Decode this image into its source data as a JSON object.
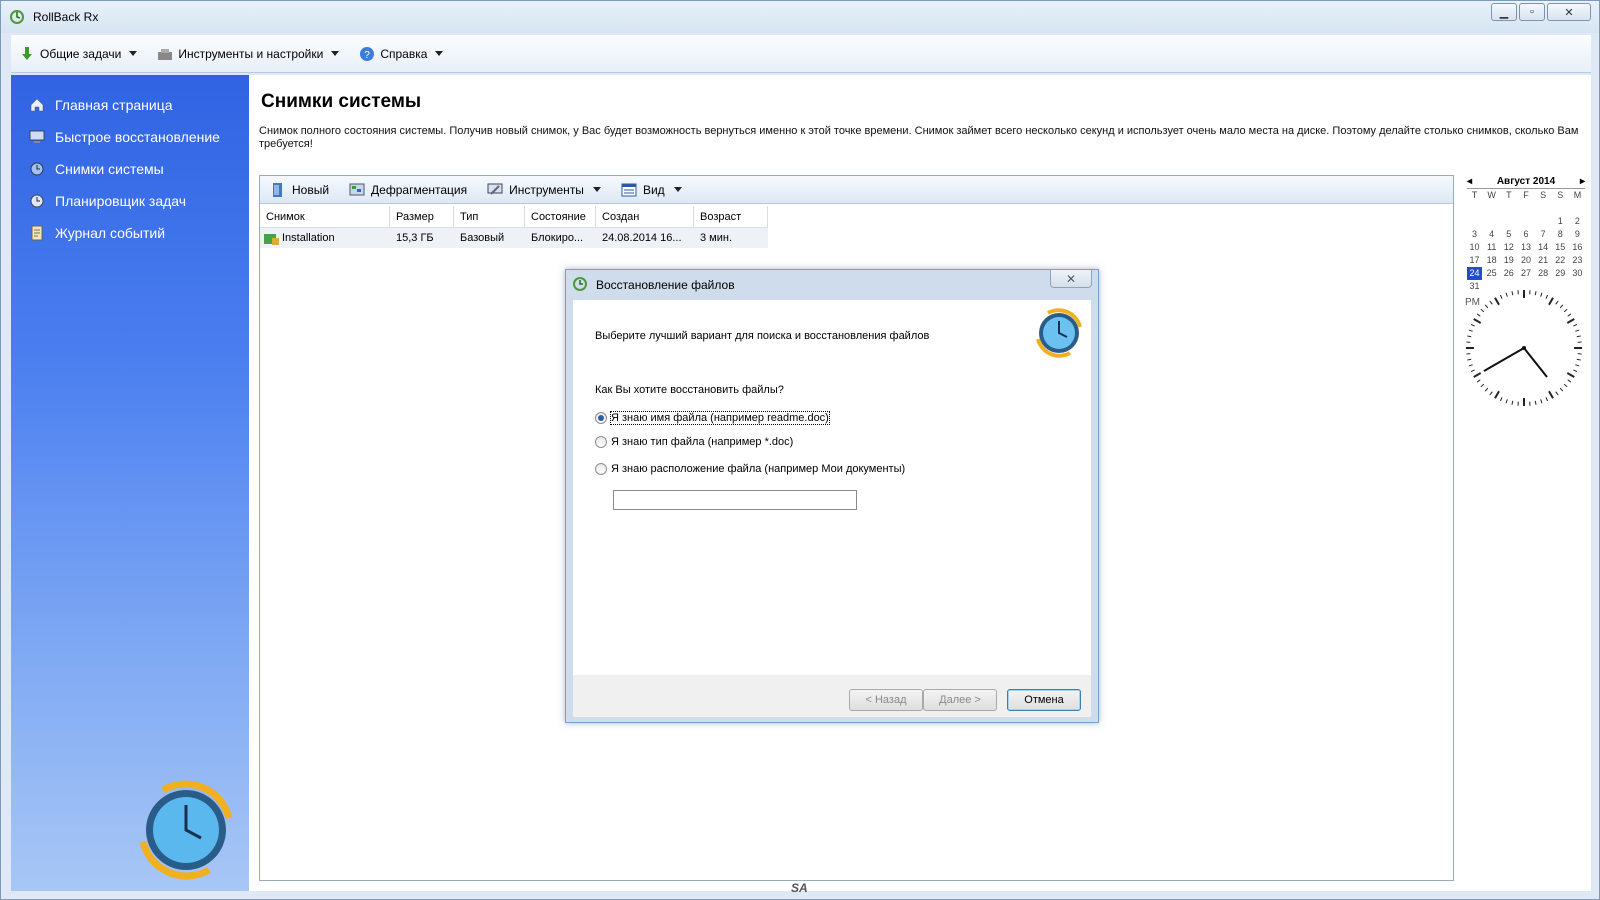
{
  "window": {
    "title": "RollBack Rx",
    "btn_min": "▁",
    "btn_max": "▫",
    "btn_close": "✕"
  },
  "menubar": {
    "items": [
      {
        "label": "Общие задачи",
        "icon": "download-arrow-icon"
      },
      {
        "label": "Инструменты и настройки",
        "icon": "tools-icon"
      },
      {
        "label": "Справка",
        "icon": "help-icon"
      }
    ]
  },
  "sidebar": {
    "items": [
      {
        "label": "Главная страница",
        "icon": "home-icon"
      },
      {
        "label": "Быстрое восстановление",
        "icon": "monitor-icon"
      },
      {
        "label": "Снимки системы",
        "icon": "snapshot-icon"
      },
      {
        "label": "Планировщик задач",
        "icon": "clock-icon"
      },
      {
        "label": "Журнал событий",
        "icon": "log-icon"
      }
    ]
  },
  "main": {
    "title": "Снимки системы",
    "description": "Снимок полного состояния системы. Получив новый снимок, у Вас будет возможность вернуться именно к этой точке времени. Снимок займет всего несколько секунд и использует очень мало места на диске. Поэтому делайте столько снимков, сколько Вам требуется!",
    "toolbar": {
      "new": "Новый",
      "defrag": "Дефрагментация",
      "tools": "Инструменты",
      "view": "Вид"
    },
    "table": {
      "columns": [
        "Снимок",
        "Размер",
        "Тип",
        "Состояние",
        "Создан",
        "Возраст"
      ],
      "rows": [
        {
          "name": "Installation",
          "size": "15,3 ГБ",
          "type": "Базовый",
          "state": "Блокиро...",
          "created": "24.08.2014 16...",
          "age": "3 мин."
        }
      ]
    }
  },
  "calendar": {
    "month": "Август 2014",
    "weekdays": [
      "T",
      "W",
      "T",
      "F",
      "S",
      "S",
      "M"
    ],
    "days": [
      "",
      "",
      "",
      "",
      "",
      "",
      "",
      "",
      "",
      "",
      "",
      "",
      "1",
      "2",
      "3",
      "4",
      "5",
      "6",
      "7",
      "8",
      "9",
      "10",
      "11",
      "12",
      "13",
      "14",
      "15",
      "16",
      "17",
      "18",
      "19",
      "20",
      "21",
      "22",
      "23",
      "24",
      "25",
      "26",
      "27",
      "28",
      "29",
      "30",
      "31"
    ],
    "selected": "24"
  },
  "clock": {
    "ampm": "PM"
  },
  "dialog": {
    "title": "Восстановление файлов",
    "close": "✕",
    "intro": "Выберите лучший вариант для поиска и восстановления файлов",
    "question": "Как Вы хотите восстановить файлы?",
    "options": [
      "Я знаю имя файла (например readme.doc)",
      "Я знаю тип файла (например *.doc)",
      "Я знаю расположение файла (например Мои документы)"
    ],
    "input_value": "",
    "btn_back": "< Назад",
    "btn_next": "Далее >",
    "btn_cancel": "Отмена"
  },
  "footer": {
    "mark": "SA"
  }
}
